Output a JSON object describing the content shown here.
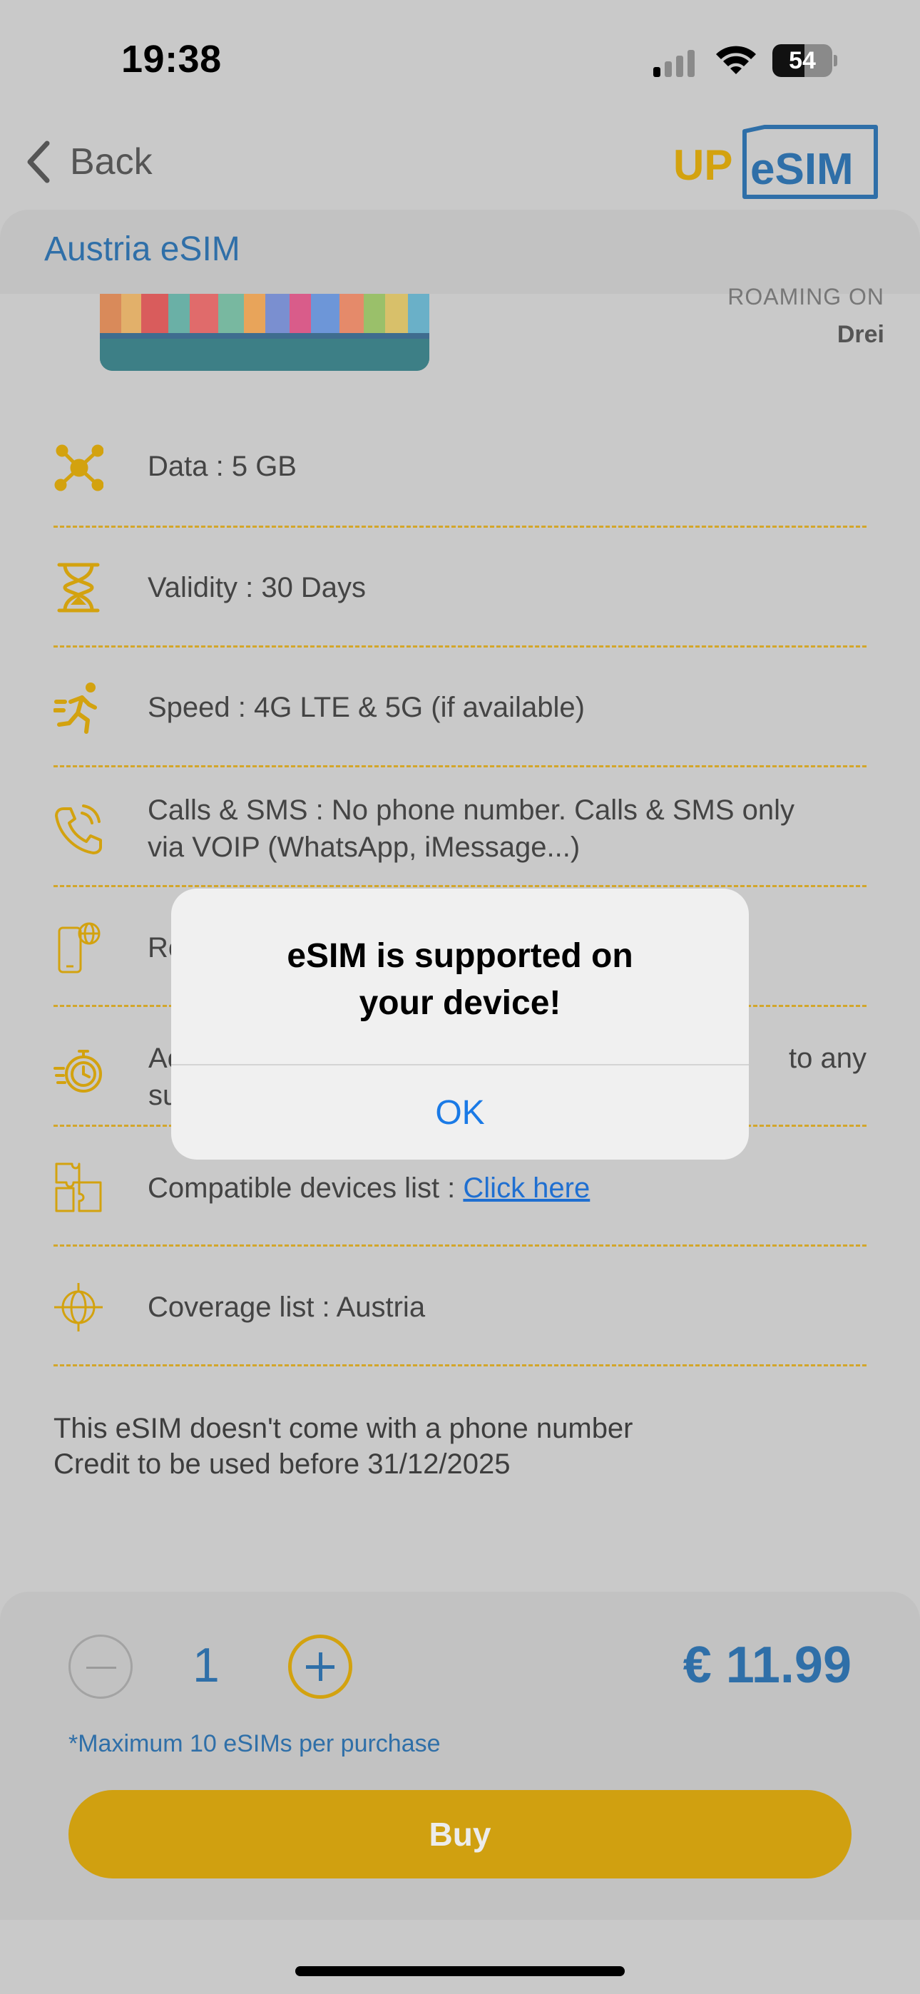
{
  "status_bar": {
    "time": "19:38",
    "battery": "54",
    "battery_level": 0.54
  },
  "header": {
    "back_label": "Back",
    "logo_up": "UP",
    "logo_esim": "eSIM"
  },
  "page_title": "Austria eSIM",
  "roaming": {
    "label": "ROAMING ON",
    "network": "Drei"
  },
  "features": [
    {
      "icon": "network-nodes-icon",
      "text": "Data : 5 GB"
    },
    {
      "icon": "hourglass-icon",
      "text": "Validity : 30 Days"
    },
    {
      "icon": "running-person-icon",
      "text": "Speed : 4G LTE & 5G (if available)"
    },
    {
      "icon": "phone-call-icon",
      "line1": "Calls & SMS : No phone number. Calls & SMS only",
      "line2": "via VOIP (WhatsApp, iMessage...)"
    },
    {
      "icon": "phone-globe-icon",
      "text": "Ro"
    },
    {
      "icon": "stopwatch-icon",
      "line1_left": "Ac",
      "line1_right": "to any",
      "line2": "su"
    },
    {
      "icon": "puzzle-icon",
      "prefix": "Compatible devices list : ",
      "link": "Click here"
    },
    {
      "icon": "globe-target-icon",
      "text": "Coverage list : Austria"
    }
  ],
  "note": {
    "line1": "This eSIM doesn't come with a phone number",
    "line2": "Credit to be used before 31/12/2025"
  },
  "purchase": {
    "quantity": "1",
    "price": "€ 11.99",
    "max_note": "*Maximum 10 eSIMs per purchase",
    "buy_label": "Buy"
  },
  "alert": {
    "title_line1": "eSIM is supported on",
    "title_line2": "your device!",
    "ok_label": "OK"
  },
  "colors": {
    "accent_blue": "#2f6fa8",
    "accent_gold": "#d0a010",
    "link_blue": "#1f6fd1"
  }
}
